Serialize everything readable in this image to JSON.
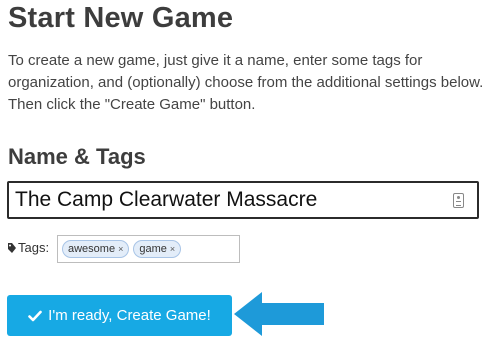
{
  "page": {
    "title": "Start New Game",
    "intro": "To create a new game, just give it a name, enter some tags for organization, and (optionally) choose from the additional settings below. Then click the \"Create Game\" button."
  },
  "name_tags": {
    "heading": "Name & Tags",
    "game_name_value": "The Camp Clearwater Massacre",
    "field_icon": "contact-card-icon",
    "tags_label": "Tags:",
    "tags_icon": "tag-icon",
    "tags": [
      {
        "label": "awesome",
        "remove": "×"
      },
      {
        "label": "game",
        "remove": "×"
      }
    ]
  },
  "actions": {
    "create_label": "I'm ready, Create Game!",
    "create_icon": "checkmark-icon"
  },
  "annotation": {
    "arrow_icon": "left-arrow-icon",
    "arrow_color": "#1e9ad9"
  },
  "colors": {
    "button_bg": "#17a9e4",
    "chip_bg": "#e3edf9",
    "chip_border": "#a8c4e6"
  }
}
